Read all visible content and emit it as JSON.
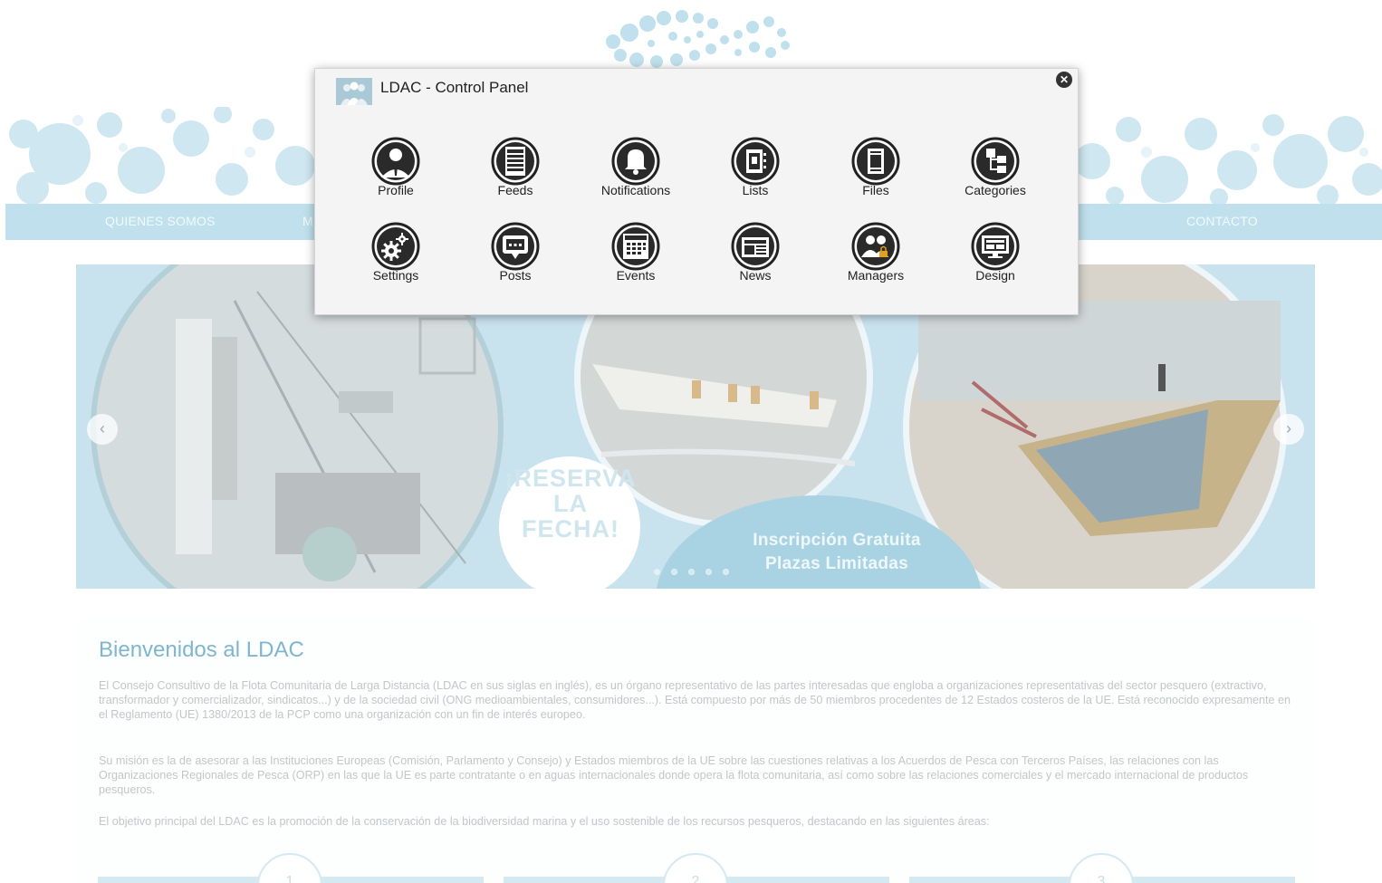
{
  "site": {
    "nav": [
      {
        "label": "QUIENES SOMOS"
      },
      {
        "label": "M"
      },
      {
        "label": "CONTACTO"
      }
    ],
    "slider": {
      "reserva": [
        "¡RESERVA",
        "LA",
        "FECHA!"
      ],
      "inscripcion": [
        "Inscripción Gratuita",
        "Plazas Limitadas"
      ],
      "prev_arrow": "‹",
      "next_arrow": "›"
    },
    "welcome": {
      "title": "Bienvenidos al LDAC",
      "paragraphs": [
        "El Consejo Consultivo de la Flota Comunitaria de Larga Distancia (LDAC en sus siglas en inglés), es un órgano representativo de las partes interesadas que engloba a organizaciones representativas del sector pesquero (extractivo, transformador y comercializador, sindicatos...) y de la sociedad civil (ONG medioambientales, consumidores...). Está compuesto por más de 50 miembros procedentes de 12 Estados costeros de la UE. Está reconocido expresamente en el Reglamento (UE) 1380/2013 de la PCP como una organización con un fin de interés europeo.",
        "Su misión es la de asesorar a las Instituciones Europeas (Comisión, Parlamento y Consejo) y Estados miembros de la UE sobre las cuestiones relativas a los Acuerdos de Pesca con Terceros Países, las relaciones con las Organizaciones Regionales de Pesca (ORP) en las que la UE es parte contratante o en aguas internacionales donde opera la flota comunitaria, así como sobre las relaciones comerciales y el mercado internacional de productos pesqueros.",
        "El objetivo principal del LDAC es la promoción de la conservación de la biodiversidad marina y el uso sostenible de los recursos pesqueros, destacando en las siguientes áreas:"
      ],
      "areas": [
        "1",
        "2",
        "3"
      ]
    }
  },
  "panel": {
    "title": "LDAC - Control Panel",
    "close_label": "✕",
    "tiles": [
      {
        "label": "Profile",
        "icon": "profile-icon"
      },
      {
        "label": "Feeds",
        "icon": "feeds-icon"
      },
      {
        "label": "Notifications",
        "icon": "bell-icon"
      },
      {
        "label": "Lists",
        "icon": "lists-icon"
      },
      {
        "label": "Files",
        "icon": "files-icon"
      },
      {
        "label": "Categories",
        "icon": "categories-icon"
      },
      {
        "label": "Settings",
        "icon": "gears-icon"
      },
      {
        "label": "Posts",
        "icon": "posts-icon"
      },
      {
        "label": "Events",
        "icon": "calendar-icon"
      },
      {
        "label": "News",
        "icon": "newspaper-icon"
      },
      {
        "label": "Managers",
        "icon": "managers-icon"
      },
      {
        "label": "Design",
        "icon": "monitor-icon"
      }
    ]
  },
  "colors": {
    "nav_bar": "#bfe0ec",
    "slider_bg": "#c9e3ee",
    "title_blue": "#7fb6cf",
    "panel_bg": "#f4f4f4",
    "icon_dark": "#222222"
  }
}
